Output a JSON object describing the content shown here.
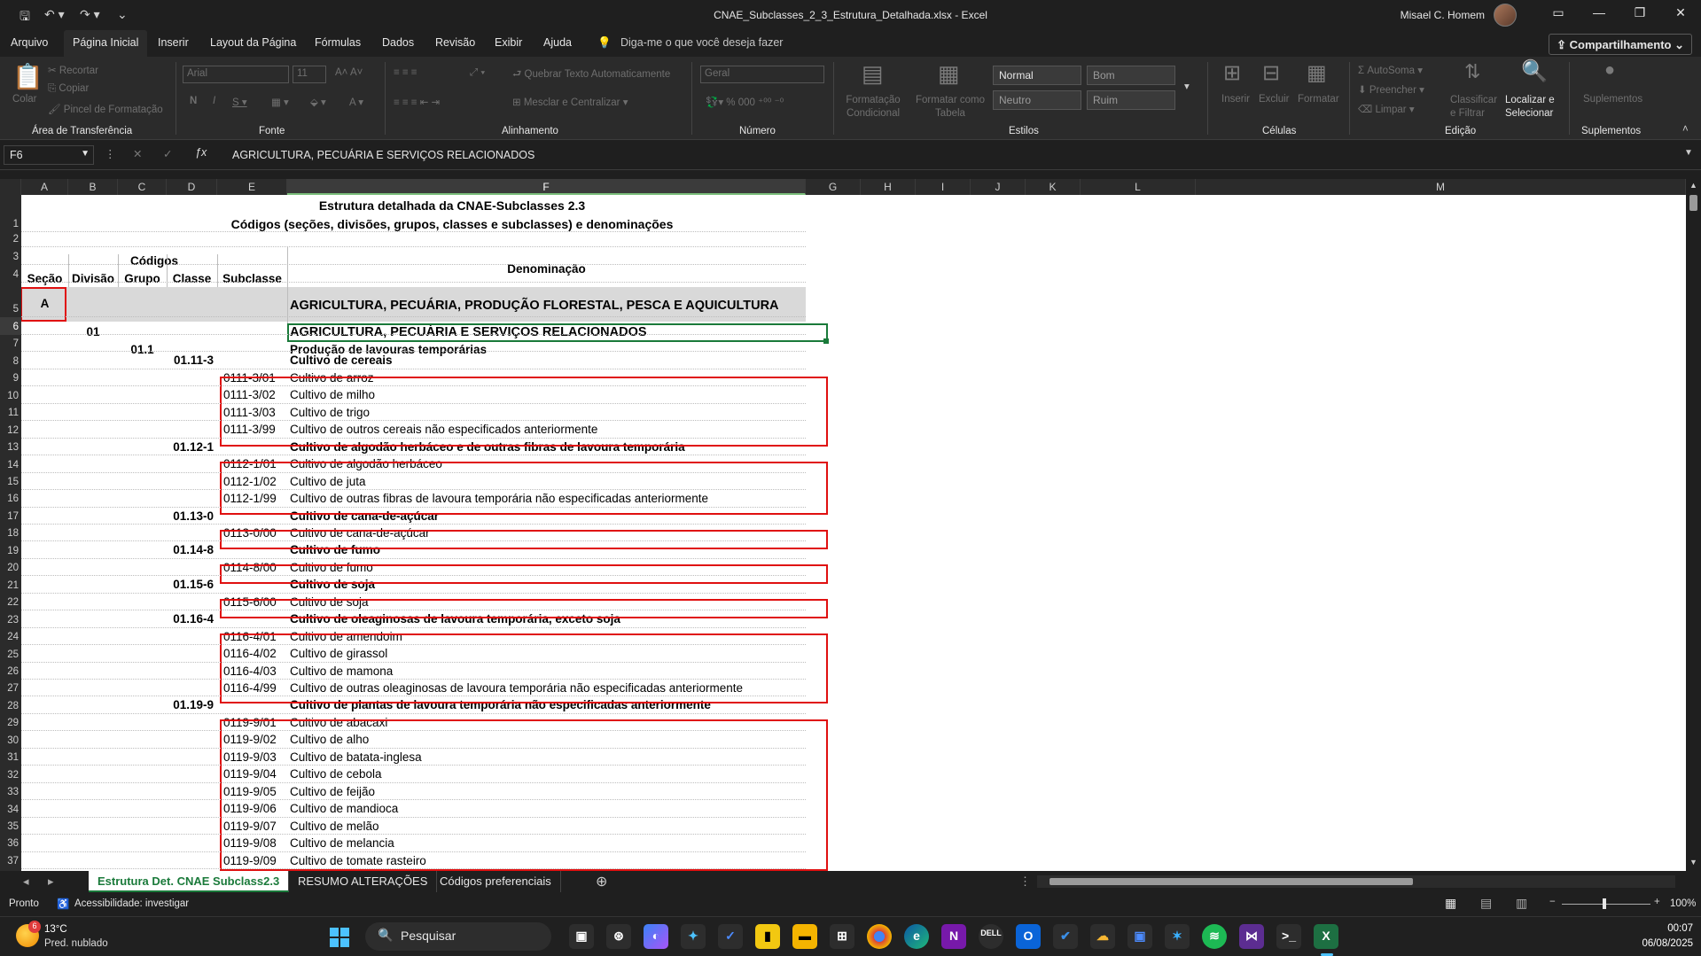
{
  "window": {
    "title": "CNAE_Subclasses_2_3_Estrutura_Detalhada.xlsx  -  Excel",
    "user": "Misael C. Homem"
  },
  "menu": {
    "tabs": [
      "Arquivo",
      "Página Inicial",
      "Inserir",
      "Layout da Página",
      "Fórmulas",
      "Dados",
      "Revisão",
      "Exibir",
      "Ajuda"
    ],
    "active_tab": "Página Inicial",
    "tell_me": "Diga-me o que você deseja fazer",
    "share": "Compartilhamento"
  },
  "ribbon": {
    "clipboard": {
      "label": "Área de Transferência",
      "paste": "Colar",
      "cut": "Recortar",
      "copy": "Copiar",
      "painter": "Pincel de Formatação"
    },
    "font": {
      "label": "Fonte",
      "name": "Arial",
      "size": "11"
    },
    "alignment": {
      "label": "Alinhamento",
      "wrap": "Quebrar Texto Automaticamente",
      "merge": "Mesclar e Centralizar"
    },
    "number": {
      "label": "Número",
      "format": "Geral"
    },
    "styles": {
      "label": "Estilos",
      "conditional": "Formatação Condicional",
      "table": "Formatar como Tabela",
      "normal": "Normal",
      "good": "Bom",
      "neutral": "Neutro",
      "bad": "Ruim"
    },
    "cells": {
      "label": "Células",
      "insert": "Inserir",
      "delete": "Excluir",
      "format": "Formatar"
    },
    "editing": {
      "label": "Edição",
      "autosum": "AutoSoma",
      "fill": "Preencher",
      "clear": "Limpar",
      "sort": "Classificar e Filtrar",
      "find": "Localizar e Selecionar"
    },
    "addins": {
      "label": "Suplementos",
      "button": "Suplementos"
    }
  },
  "formula_bar": {
    "name_box": "F6",
    "content": "AGRICULTURA, PECUÁRIA E SERVIÇOS RELACIONADOS"
  },
  "columns": [
    "A",
    "B",
    "C",
    "D",
    "E",
    "F",
    "G",
    "H",
    "I",
    "J",
    "K",
    "L",
    "M"
  ],
  "rows": [
    "1",
    "2",
    "3",
    "4",
    "5",
    "6",
    "7",
    "8",
    "9",
    "10",
    "11",
    "12",
    "13",
    "14",
    "15",
    "16",
    "17",
    "18",
    "19",
    "20",
    "21",
    "22",
    "23",
    "24",
    "25",
    "26",
    "27",
    "28",
    "29",
    "30",
    "31",
    "32",
    "33",
    "34",
    "35",
    "36",
    "37"
  ],
  "sheet": {
    "title1": "Estrutura detalhada da CNAE-Subclasses 2.3",
    "title2": "Códigos (seções, divisões, grupos, classes e subclasses) e denominações",
    "codes_header": "Códigos",
    "denomination_header": "Denominação",
    "h_secao": "Seção",
    "h_divisao": "Divisão",
    "h_grupo": "Grupo",
    "h_classe": "Classe",
    "h_subclasse": "Subclasse",
    "section_code": "A",
    "section_name": "AGRICULTURA, PECUÁRIA, PRODUÇÃO FLORESTAL, PESCA E AQUICULTURA",
    "division_code": "01",
    "division_name": "AGRICULTURA, PECUÁRIA E SERVIÇOS RELACIONADOS",
    "group_code": "01.1",
    "group_name": "Produção de lavouras temporárias",
    "entries": [
      {
        "row": 8,
        "classe": "01.11-3",
        "name": "Cultivo de cereais",
        "bold": true
      },
      {
        "row": 9,
        "sub": "0111-3/01",
        "name": "Cultivo de arroz"
      },
      {
        "row": 10,
        "sub": "0111-3/02",
        "name": "Cultivo de milho"
      },
      {
        "row": 11,
        "sub": "0111-3/03",
        "name": "Cultivo de trigo"
      },
      {
        "row": 12,
        "sub": "0111-3/99",
        "name": "Cultivo de outros cereais não especificados anteriormente"
      },
      {
        "row": 13,
        "classe": "01.12-1",
        "name": "Cultivo de algodão herbáceo e de outras fibras de lavoura temporária",
        "bold": true
      },
      {
        "row": 14,
        "sub": "0112-1/01",
        "name": "Cultivo de algodão herbáceo"
      },
      {
        "row": 15,
        "sub": "0112-1/02",
        "name": "Cultivo de juta"
      },
      {
        "row": 16,
        "sub": "0112-1/99",
        "name": "Cultivo de outras fibras de lavoura temporária não especificadas anteriormente"
      },
      {
        "row": 17,
        "classe": "01.13-0",
        "name": "Cultivo de cana-de-açúcar",
        "bold": true
      },
      {
        "row": 18,
        "sub": "0113-0/00",
        "name": "Cultivo de cana-de-açúcar"
      },
      {
        "row": 19,
        "classe": "01.14-8",
        "name": "Cultivo de fumo",
        "bold": true
      },
      {
        "row": 20,
        "sub": "0114-8/00",
        "name": "Cultivo de fumo"
      },
      {
        "row": 21,
        "classe": "01.15-6",
        "name": "Cultivo de soja",
        "bold": true
      },
      {
        "row": 22,
        "sub": "0115-6/00",
        "name": "Cultivo de soja"
      },
      {
        "row": 23,
        "classe": "01.16-4",
        "name": "Cultivo de oleaginosas de lavoura temporária, exceto soja",
        "bold": true
      },
      {
        "row": 24,
        "sub": "0116-4/01",
        "name": "Cultivo de amendoim"
      },
      {
        "row": 25,
        "sub": "0116-4/02",
        "name": "Cultivo de girassol"
      },
      {
        "row": 26,
        "sub": "0116-4/03",
        "name": "Cultivo de mamona"
      },
      {
        "row": 27,
        "sub": "0116-4/99",
        "name": "Cultivo de outras oleaginosas de lavoura temporária não especificadas anteriormente"
      },
      {
        "row": 28,
        "classe": "01.19-9",
        "name": "Cultivo de plantas de lavoura temporária não especificadas anteriormente",
        "bold": true
      },
      {
        "row": 29,
        "sub": "0119-9/01",
        "name": "Cultivo de abacaxi"
      },
      {
        "row": 30,
        "sub": "0119-9/02",
        "name": "Cultivo de alho"
      },
      {
        "row": 31,
        "sub": "0119-9/03",
        "name": "Cultivo de batata-inglesa"
      },
      {
        "row": 32,
        "sub": "0119-9/04",
        "name": "Cultivo de cebola"
      },
      {
        "row": 33,
        "sub": "0119-9/05",
        "name": "Cultivo de feijão"
      },
      {
        "row": 34,
        "sub": "0119-9/06",
        "name": "Cultivo de mandioca"
      },
      {
        "row": 35,
        "sub": "0119-9/07",
        "name": "Cultivo de melão"
      },
      {
        "row": 36,
        "sub": "0119-9/08",
        "name": "Cultivo de melancia"
      },
      {
        "row": 37,
        "sub": "0119-9/09",
        "name": "Cultivo de tomate rasteiro"
      }
    ]
  },
  "sheet_tabs": [
    "Estrutura Det. CNAE Subclass2.3",
    "RESUMO ALTERAÇÕES",
    "Códigos preferenciais"
  ],
  "status": {
    "ready": "Pronto",
    "accessibility": "Acessibilidade: investigar",
    "zoom": "100%"
  },
  "taskbar": {
    "weather_temp": "13°C",
    "weather_desc": "Pred. nublado",
    "weather_badge": "6",
    "search": "Pesquisar",
    "time": "00:07",
    "date": "06/08/2025"
  },
  "colors": {
    "accent_green": "#1a7a3a",
    "red_box": "#e01010",
    "section_bg": "#d9d9d9"
  }
}
